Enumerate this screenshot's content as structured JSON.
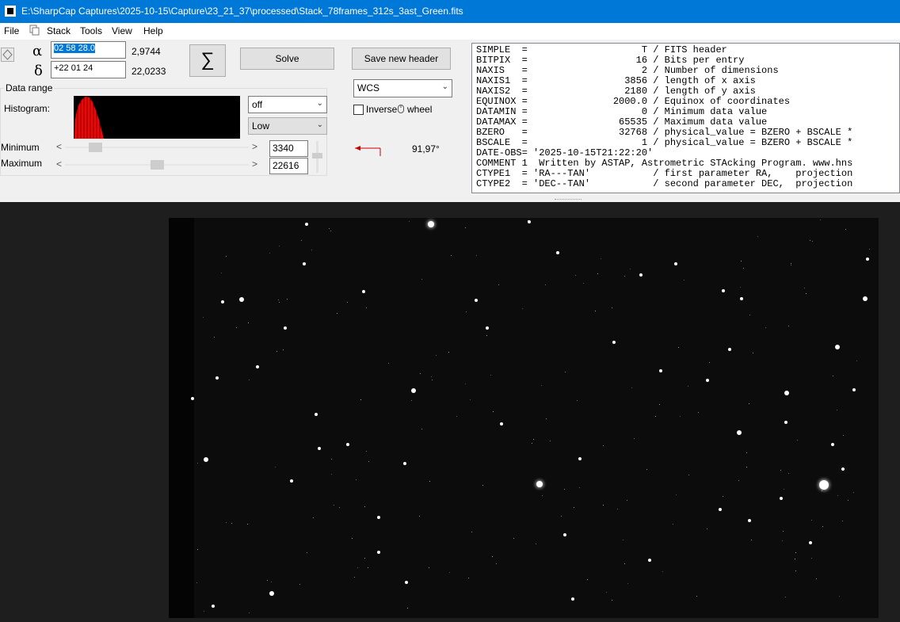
{
  "window": {
    "title": "E:\\SharpCap Captures\\2025-10-15\\Capture\\23_21_37\\processed\\Stack_78frames_312s_3ast_Green.fits"
  },
  "menu": {
    "file": "File",
    "stack": "Stack",
    "tools": "Tools",
    "view": "View",
    "help": "Help"
  },
  "coords": {
    "alpha_symbol": "α",
    "delta_symbol": "δ",
    "alpha_value": "02 58 28.0",
    "alpha_deg": "2,9744",
    "delta_value": "+22 01 24",
    "delta_deg": "22,0233"
  },
  "buttons": {
    "sigma": "∑",
    "solve": "Solve",
    "save_header": "Save new header"
  },
  "data_range": {
    "group_label": "Data range",
    "histogram_label": "Histogram:",
    "stretch_select": "off",
    "level_select": "Low",
    "minimum_label": "Minimum",
    "maximum_label": "Maximum",
    "minimum_value": "3340",
    "maximum_value": "22616",
    "minimum_slider_fraction": 0.14,
    "maximum_slider_fraction": 0.5
  },
  "wcs": {
    "select": "WCS",
    "inverse_label": "Inverse",
    "wheel_label": "wheel",
    "angle": "91,97°"
  },
  "fits_header": [
    "SIMPLE  =                    T / FITS header",
    "BITPIX  =                   16 / Bits per entry",
    "NAXIS   =                    2 / Number of dimensions",
    "NAXIS1  =                 3856 / length of x axis",
    "NAXIS2  =                 2180 / length of y axis",
    "EQUINOX =               2000.0 / Equinox of coordinates",
    "DATAMIN =                    0 / Minimum data value",
    "DATAMAX =                65535 / Maximum data value",
    "BZERO   =                32768 / physical_value = BZERO + BSCALE *",
    "BSCALE  =                    1 / physical_value = BZERO + BSCALE *",
    "DATE-OBS= '2025-10-15T21:22:20'",
    "COMMENT 1  Written by ASTAP, Astrometric STAcking Program. www.hns",
    "CTYPE1  = 'RA---TAN'           / first parameter RA,    projection",
    "CTYPE2  = 'DEC--TAN'           / second parameter DEC,  projection"
  ],
  "colors": {
    "titlebar": "#0078d7",
    "histogram": "#ff0000",
    "north_arrow": "#cc0000"
  }
}
